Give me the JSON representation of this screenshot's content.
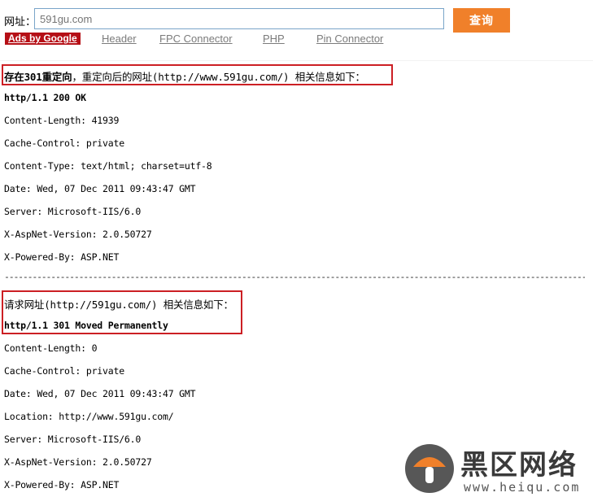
{
  "search": {
    "label": "网址：",
    "placeholder": "591gu.com",
    "button": "查询"
  },
  "ads": {
    "badge": "Ads by Google",
    "links": [
      "Header",
      "FPC Connector",
      "PHP",
      "Pin Connector"
    ]
  },
  "section1": {
    "title_bold": "存在301重定向",
    "title_rest": "，重定向后的网址(http://www.591gu.com/) 相关信息如下：",
    "status": "http/1.1 200 OK",
    "headers": [
      "Content-Length: 41939",
      "Cache-Control: private",
      "Content-Type: text/html; charset=utf-8",
      "Date: Wed, 07 Dec 2011 09:43:47 GMT",
      "Server: Microsoft-IIS/6.0",
      "X-AspNet-Version: 2.0.50727",
      "X-Powered-By: ASP.NET"
    ]
  },
  "divider": "----------------------------------------------------------------------------------------------------------------------------------------------------",
  "section2": {
    "title": "请求网址(http://591gu.com/) 相关信息如下：",
    "status": "http/1.1 301 Moved Permanently",
    "headers": [
      "Content-Length: 0",
      "Cache-Control: private",
      "Date: Wed, 07 Dec 2011 09:43:47 GMT",
      "Location: http://www.591gu.com/",
      "Server: Microsoft-IIS/6.0",
      "X-AspNet-Version: 2.0.50727",
      "X-Powered-By: ASP.NET"
    ]
  },
  "watermark": {
    "title": "黑区网络",
    "url": "www.heiqu.com",
    "icon": "mushroom-logo-icon"
  },
  "colors": {
    "button": "#f0802a",
    "ads_badge": "#b50f16",
    "highlight_box": "#cc1f24",
    "input_border": "#7aa5c9"
  }
}
